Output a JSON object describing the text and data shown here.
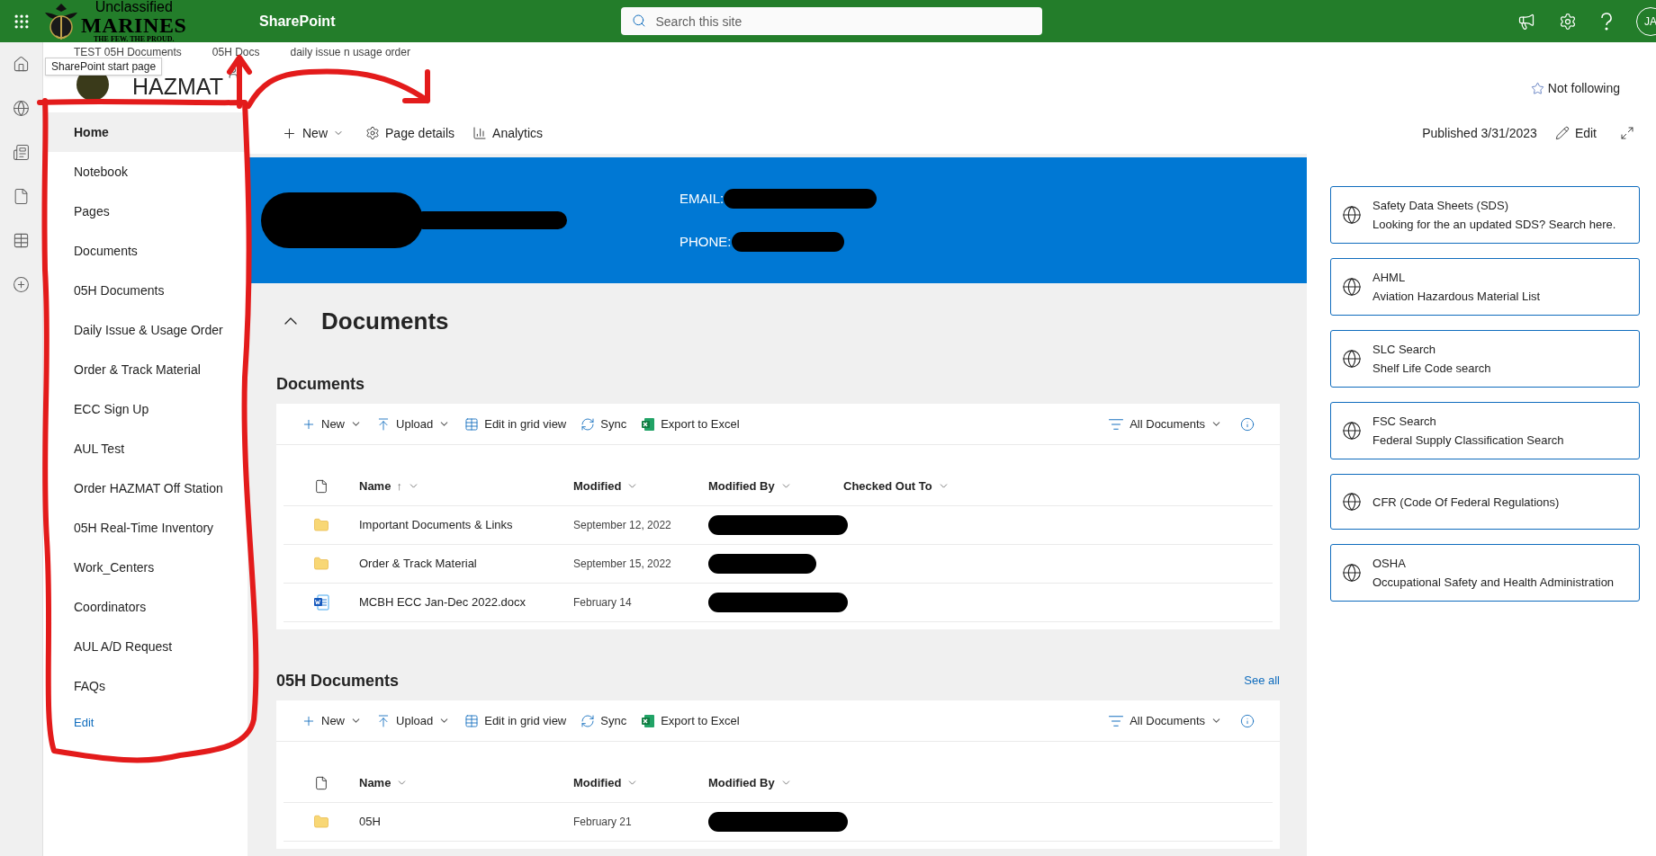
{
  "top_bar": {
    "logo": {
      "line1": "Unclassified",
      "line2": "MARINES",
      "line3": "THE FEW. THE PROUD."
    },
    "app_name": "SharePoint",
    "search": {
      "placeholder": "Search this site"
    },
    "avatar": "JA"
  },
  "hub_nav": [
    {
      "label": "TEST 05H Documents"
    },
    {
      "label": "05H Docs"
    },
    {
      "label": "daily issue n usage order"
    }
  ],
  "tooltip": "SharePoint start page",
  "site": {
    "title": "HAZMAT",
    "follow": "Not following"
  },
  "nav": [
    {
      "label": "Home",
      "selected": true
    },
    {
      "label": "Notebook",
      "selected": false
    },
    {
      "label": "Pages",
      "selected": false
    },
    {
      "label": "Documents",
      "selected": false
    },
    {
      "label": "05H Documents",
      "selected": false
    },
    {
      "label": "Daily Issue & Usage Order",
      "selected": false
    },
    {
      "label": "Order & Track Material",
      "selected": false
    },
    {
      "label": "ECC Sign Up",
      "selected": false
    },
    {
      "label": "AUL Test",
      "selected": false
    },
    {
      "label": "Order HAZMAT Off Station",
      "selected": false
    },
    {
      "label": "05H Real-Time Inventory",
      "selected": false
    },
    {
      "label": "Work_Centers",
      "selected": false
    },
    {
      "label": "Coordinators",
      "selected": false
    },
    {
      "label": "AUL A/D Request",
      "selected": false
    },
    {
      "label": "FAQs",
      "selected": false
    }
  ],
  "nav_edit": "Edit",
  "command_bar": {
    "new": "New",
    "page_details": "Page details",
    "analytics": "Analytics",
    "published": "Published 3/31/2023",
    "edit": "Edit"
  },
  "banner": {
    "email_label": "EMAIL:",
    "phone_label": "PHONE:"
  },
  "section": {
    "title": "Documents",
    "expanded": true
  },
  "libraries": [
    {
      "title": "Documents",
      "toolbar": [
        "New",
        "Upload",
        "Edit in grid view",
        "Sync",
        "Export to Excel"
      ],
      "view": "All Documents",
      "columns": [
        {
          "label": "Name",
          "sort": "↑"
        },
        {
          "label": "Modified"
        },
        {
          "label": "Modified By"
        },
        {
          "label": "Checked Out To"
        }
      ],
      "rows": [
        {
          "kind": "folder",
          "name": "Important Documents & Links",
          "modified": "September 12, 2022"
        },
        {
          "kind": "folder",
          "name": "Order & Track Material",
          "modified": "September 15, 2022"
        },
        {
          "kind": "word",
          "name": "MCBH ECC Jan-Dec 2022.docx",
          "modified": "February 14"
        }
      ]
    },
    {
      "title": "05H Documents",
      "see_all": "See all",
      "toolbar": [
        "New",
        "Upload",
        "Edit in grid view",
        "Sync",
        "Export to Excel"
      ],
      "view": "All Documents",
      "columns": [
        {
          "label": "Name"
        },
        {
          "label": "Modified"
        },
        {
          "label": "Modified By"
        }
      ],
      "rows": [
        {
          "kind": "folder",
          "name": "05H",
          "modified": "February 21"
        }
      ]
    }
  ],
  "quick_links": [
    {
      "title": "Safety Data Sheets (SDS)",
      "description": "Looking for the an updated SDS? Search here."
    },
    {
      "title": "AHML",
      "description": "Aviation Hazardous Material List"
    },
    {
      "title": "SLC Search",
      "description": "Shelf Life Code search"
    },
    {
      "title": "FSC Search",
      "description": "Federal Supply Classification Search"
    },
    {
      "title": "CFR (Code Of Federal Regulations)"
    },
    {
      "title": "OSHA",
      "description": "Occupational Safety and Health Administration"
    }
  ]
}
